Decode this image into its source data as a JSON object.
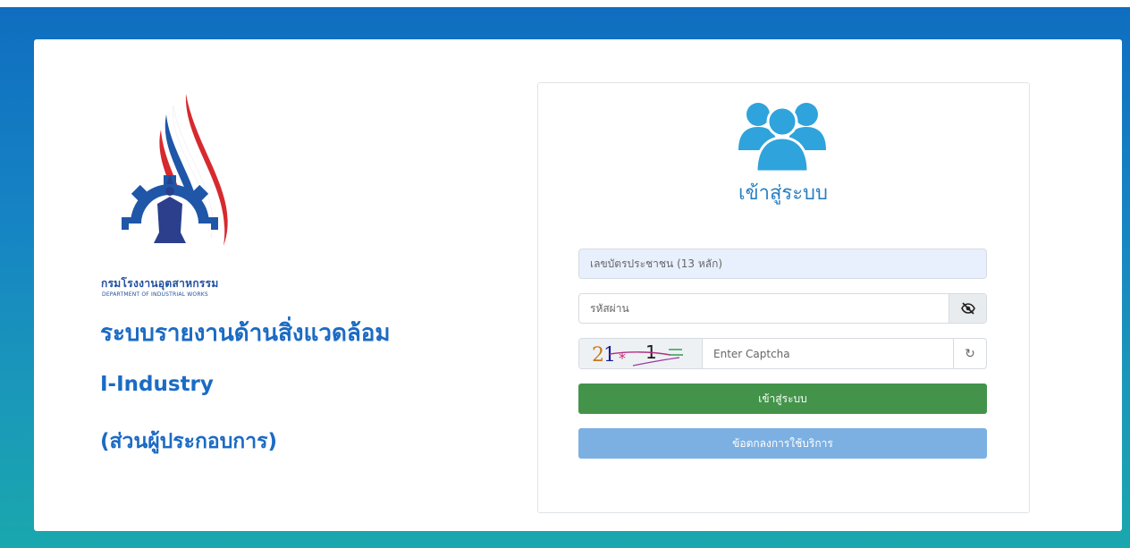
{
  "brand": {
    "dept_th": "กรมโรงงานอุตสาหกรรม",
    "dept_en": "DEPARTMENT OF INDUSTRIAL WORKS",
    "system_title": "ระบบรายงานด้านสิ่งแวดล้อม",
    "system_name": "I-Industry",
    "system_sub": "(ส่วนผู้ประกอบการ)"
  },
  "login": {
    "heading": "เข้าสู่ระบบ",
    "id_placeholder": "เลขบัตรประชาชน (13 หลัก)",
    "password_placeholder": "รหัสผ่าน",
    "captcha_placeholder": "Enter Captcha",
    "captcha_text": "21 1",
    "refresh_symbol": "↻",
    "login_button": "เข้าสู่ระบบ",
    "terms_button": "ข้อตกลงการใช้บริการ"
  },
  "colors": {
    "primary_blue": "#1b6bc4",
    "login_green": "#43944a",
    "terms_blue": "#7db0e2",
    "icon_blue": "#2fa3dc"
  },
  "icons": {
    "users": "users-icon",
    "eye": "eye-slash-icon",
    "refresh": "refresh-icon"
  }
}
